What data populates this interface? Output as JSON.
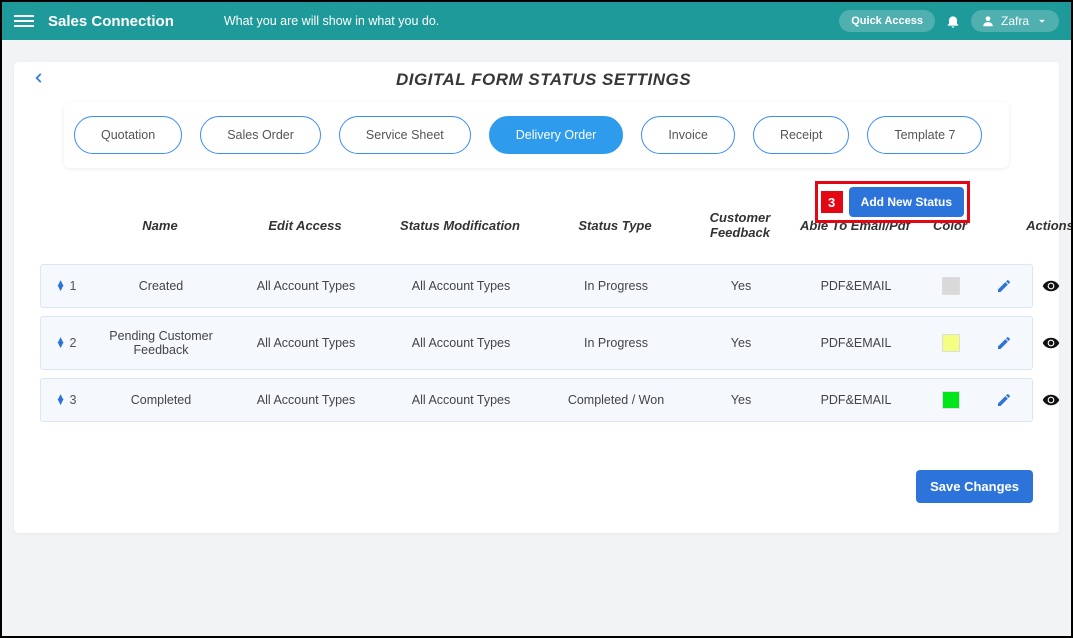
{
  "header": {
    "brand": "Sales Connection",
    "tagline": "What you are will show in what you do.",
    "quick_access": "Quick Access",
    "user_name": "Zafra"
  },
  "page": {
    "title": "DIGITAL FORM STATUS SETTINGS"
  },
  "tabs": [
    {
      "label": "Quotation",
      "active": false
    },
    {
      "label": "Sales Order",
      "active": false
    },
    {
      "label": "Service Sheet",
      "active": false
    },
    {
      "label": "Delivery Order",
      "active": true
    },
    {
      "label": "Invoice",
      "active": false
    },
    {
      "label": "Receipt",
      "active": false
    },
    {
      "label": "Template 7",
      "active": false
    }
  ],
  "callout": {
    "number": "3"
  },
  "buttons": {
    "add_new_status": "Add New Status",
    "save_changes": "Save Changes"
  },
  "columns": [
    "",
    "Name",
    "Edit Access",
    "Status Modification",
    "Status Type",
    "Customer Feedback",
    "Able To Email/Pdf",
    "Color",
    "Actions"
  ],
  "rows": [
    {
      "order": "1",
      "name": "Created",
      "edit_access": "All Account Types",
      "status_mod": "All Account Types",
      "status_type": "In Progress",
      "feedback": "Yes",
      "email_pdf": "PDF&EMAIL",
      "color": "#d9d9d9"
    },
    {
      "order": "2",
      "name": "Pending Customer Feedback",
      "edit_access": "All Account Types",
      "status_mod": "All Account Types",
      "status_type": "In Progress",
      "feedback": "Yes",
      "email_pdf": "PDF&EMAIL",
      "color": "#f4ff81"
    },
    {
      "order": "3",
      "name": "Completed",
      "edit_access": "All Account Types",
      "status_mod": "All Account Types",
      "status_type": "Completed / Won",
      "feedback": "Yes",
      "email_pdf": "PDF&EMAIL",
      "color": "#00e61a"
    }
  ]
}
